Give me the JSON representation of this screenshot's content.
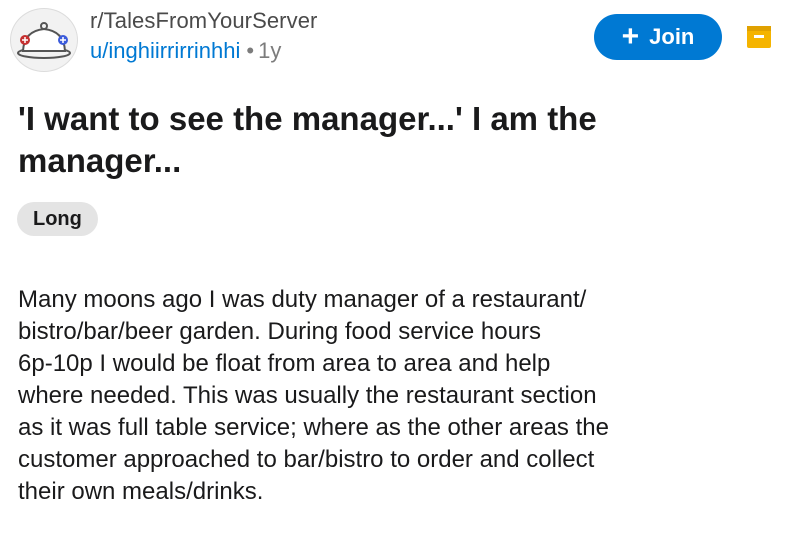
{
  "post": {
    "subreddit": "r/TalesFromYourServer",
    "username": "u/inghiirrirrinhhi",
    "separator": "•",
    "age": "1y",
    "join_label": "Join",
    "title": "'I want to see the manager...' I am the manager...",
    "flair": "Long",
    "body_lines": [
      "Many moons ago I was duty manager of a restaurant/",
      "bistro/bar/beer garden.  During food service hours",
      "6p-10p I would be float from area to area and help",
      "where needed. This was usually the restaurant section",
      "as it was full table service; where as the other areas the",
      "customer approached to bar/bistro to order and collect",
      "their own meals/drinks."
    ]
  },
  "icons": {
    "avatar": "subreddit-avatar-cloche-icon",
    "join": "plus-icon",
    "save": "save-icon"
  },
  "colors": {
    "accent": "#0079d3",
    "save_icon": "#f5b400",
    "flair_bg": "#e4e4e4",
    "meta_text": "#7c7c7c"
  }
}
